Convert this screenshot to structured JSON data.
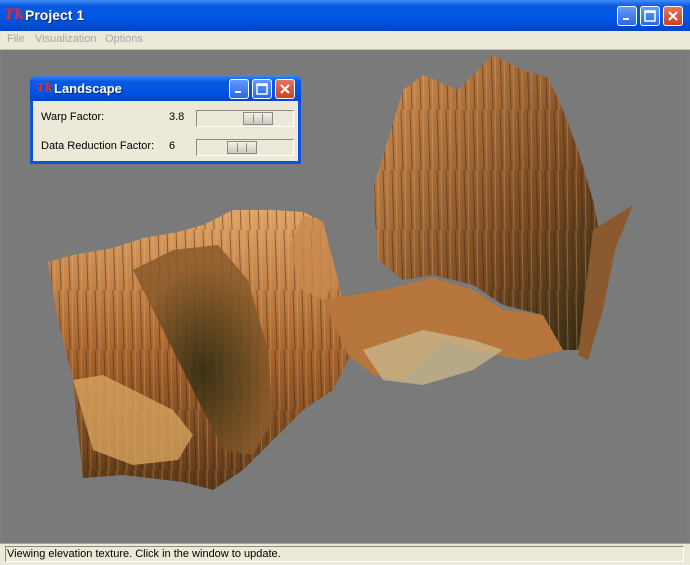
{
  "window": {
    "title": "Project 1",
    "icon": "tk-logo-icon"
  },
  "menu": {
    "items": [
      "File",
      "Visualization",
      "Options"
    ]
  },
  "dialog": {
    "title": "Landscape",
    "rows": [
      {
        "label": "Warp Factor:",
        "value": "3.8",
        "slider_fraction": 0.7
      },
      {
        "label": "Data Reduction Factor:",
        "value": "6",
        "slider_fraction": 0.45
      }
    ]
  },
  "status": {
    "text": "Viewing elevation texture. Click in the window to update."
  },
  "colors": {
    "titlebar": "#0055e5",
    "viewport_bg": "#7a7a7a",
    "terrain_light": "#c88a4a",
    "terrain_dark": "#3b2a14"
  }
}
